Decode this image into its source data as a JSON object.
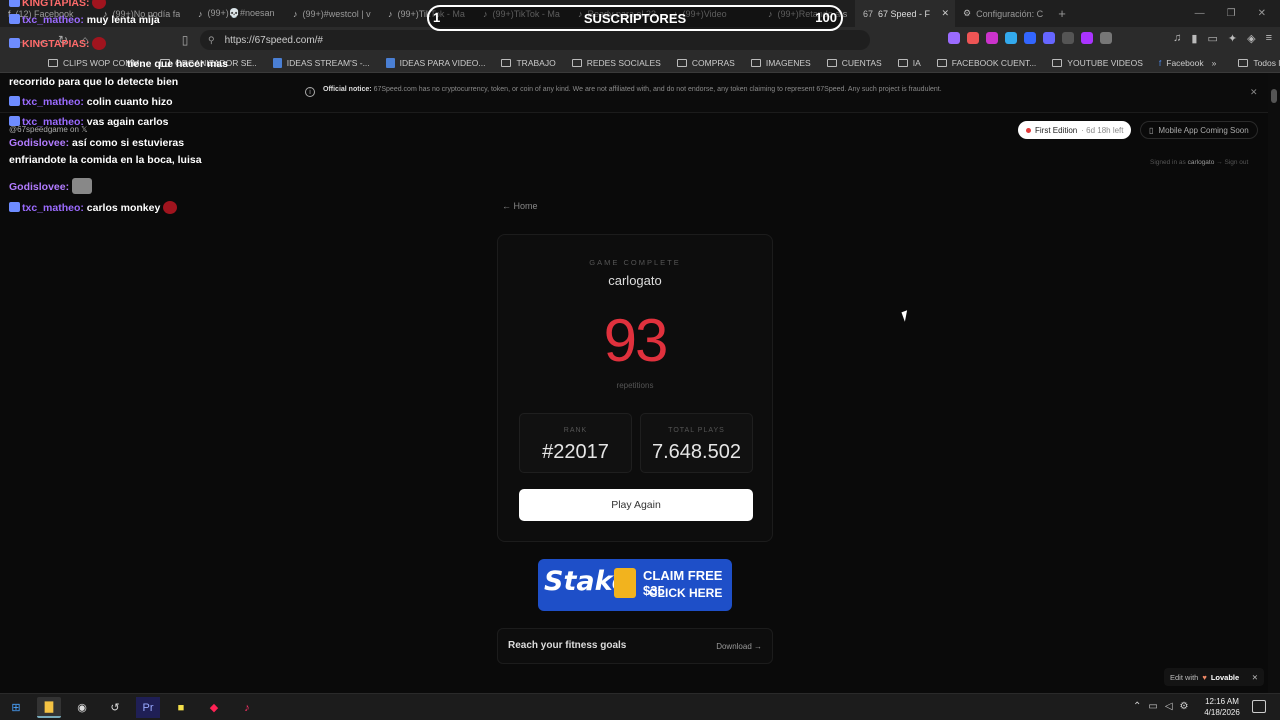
{
  "browser": {
    "tabs": [
      {
        "label": "(12) Facebook",
        "icon": "facebook-icon"
      },
      {
        "label": "(99+)No podía fa",
        "icon": "tiktok-icon"
      },
      {
        "label": "(99+)💀#noesan",
        "icon": "tiktok-icon"
      },
      {
        "label": "(99+)#westcol | v",
        "icon": "tiktok-icon"
      },
      {
        "label": "(99+)TikTok - Ma",
        "icon": "tiktok-icon"
      },
      {
        "label": "(99+)TikTok - Ma",
        "icon": "tiktok-icon"
      },
      {
        "label": "Ready para el 23",
        "icon": "tiktok-icon"
      },
      {
        "label": "(99+)Video",
        "icon": "tiktok-icon"
      },
      {
        "label": "(99+)Retando a s",
        "icon": "tiktok-icon"
      },
      {
        "label": "67 Speed - F",
        "icon": "67-icon",
        "active": true
      },
      {
        "label": "Configuración: C",
        "icon": "gear-icon"
      }
    ],
    "url": "https://67speed.com/#",
    "bookmarks": [
      {
        "label": "CLIPS WOP COMM..",
        "type": "folder"
      },
      {
        "label": "ORGANIZADOR SE..",
        "type": "folder"
      },
      {
        "label": "IDEAS STREAM'S -...",
        "type": "doc"
      },
      {
        "label": "IDEAS PARA VIDEO...",
        "type": "doc"
      },
      {
        "label": "TRABAJO",
        "type": "folder"
      },
      {
        "label": "REDES SOCIALES",
        "type": "folder"
      },
      {
        "label": "COMPRAS",
        "type": "folder"
      },
      {
        "label": "IMAGENES",
        "type": "folder"
      },
      {
        "label": "CUENTAS",
        "type": "folder"
      },
      {
        "label": "IA",
        "type": "folder"
      },
      {
        "label": "FACEBOOK CUENT...",
        "type": "folder"
      },
      {
        "label": "YOUTUBE VIDEOS",
        "type": "folder"
      },
      {
        "label": "Facebook",
        "type": "facebook"
      }
    ],
    "all_bookmarks": "Todos los marcadores"
  },
  "site": {
    "notice_title": "Official notice:",
    "notice_text": "67Speed.com has no cryptocurrency, token, or coin of any kind. We are not affiliated with, and do not endorse, any token claiming to represent 67Speed. Any such project is fraudulent.",
    "edition_label": "First Edition",
    "edition_left": "· 6d 18h left",
    "mobile_label": "Mobile App Coming Soon",
    "signed_prefix": "Signed in as",
    "signed_user": "carlogato",
    "sign_out": "→ Sign out",
    "home_link": "← Home",
    "game_complete": "GAME COMPLETE",
    "username": "carlogato",
    "score": "93",
    "score_unit": "repetitions",
    "rank_label": "RANK",
    "rank_value": "#22017",
    "plays_label": "TOTAL PLAYS",
    "plays_value": "7.648.502",
    "play_again": "Play Again",
    "ad_brand": "Stake",
    "ad_line1": "CLAIM FREE $35",
    "ad_line2": "CLICK HERE",
    "fitness_title": "Reach your fitness goals",
    "fitness_link": "Download →",
    "lovable_prefix": "Edit with",
    "lovable_brand": "Lovable"
  },
  "overlay": {
    "subscribers_label": "SUSCRIPTORES",
    "progress_start": "1",
    "progress_goal": "100",
    "chat": [
      {
        "user": "KINGTAPIAS:",
        "text": "",
        "color": "#ff6b6b"
      },
      {
        "user": "txc_matheo:",
        "text": "muy lenta mija",
        "color": "#9b6bff"
      },
      {
        "user": "KINGTAPIAS:",
        "text": "",
        "color": "#ff6b6b"
      },
      {
        "user": "",
        "text": "tiene que hacer mas",
        "color": "#ffffff"
      },
      {
        "user": "",
        "text": "recorrido para que lo detecte bien",
        "color": "#ffffff"
      },
      {
        "user": "txc_matheo:",
        "text": "colin cuanto hizo",
        "color": "#9b6bff"
      },
      {
        "user": "txc_matheo:",
        "text": "vas again carlos",
        "color": "#9b6bff"
      },
      {
        "user": "Godislovee:",
        "text": "así como si estuvieras",
        "color": "#b27cff"
      },
      {
        "user": "",
        "text": "enfriandote la comida en la boca, luisa",
        "color": "#ffffff"
      },
      {
        "user": "Godislovee:",
        "text": "",
        "color": "#b27cff"
      },
      {
        "user": "txc_matheo:",
        "text": "carlos monkey",
        "color": "#9b6bff"
      }
    ],
    "social_handle": "@67speedgame on 𝕏"
  },
  "taskbar": {
    "time": "12:16 AM",
    "date": "4/18/2026"
  }
}
